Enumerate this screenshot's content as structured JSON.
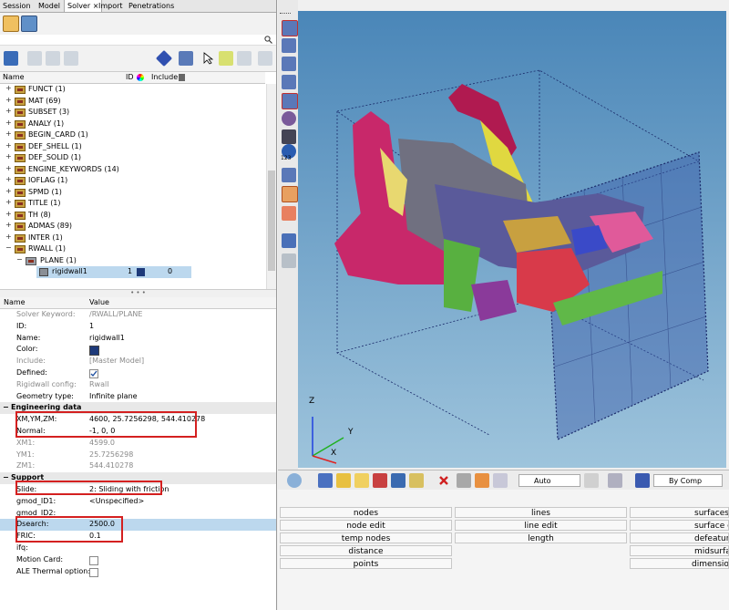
{
  "tabs": [
    "Session",
    "Model",
    "Solver",
    "Import",
    "Penetrations"
  ],
  "active_tab_close": "×",
  "tree": {
    "columns": {
      "name": "Name",
      "id": "ID",
      "include": "Include"
    },
    "items": [
      {
        "label": "FUNCT  (1)"
      },
      {
        "label": "MAT  (69)"
      },
      {
        "label": "SUBSET  (3)"
      },
      {
        "label": "ANALY  (1)"
      },
      {
        "label": "BEGIN_CARD  (1)"
      },
      {
        "label": "DEF_SHELL  (1)"
      },
      {
        "label": "DEF_SOLID  (1)"
      },
      {
        "label": "ENGINE_KEYWORDS  (14)"
      },
      {
        "label": "IOFLAG  (1)"
      },
      {
        "label": "SPMD  (1)"
      },
      {
        "label": "TITLE  (1)"
      },
      {
        "label": "TH  (8)"
      },
      {
        "label": "ADMAS  (89)"
      },
      {
        "label": "INTER  (1)"
      },
      {
        "label": "RWALL  (1)"
      },
      {
        "label": "PLANE  (1)"
      }
    ],
    "selected": {
      "label": "rigidwall1",
      "id": "1",
      "include": "0"
    }
  },
  "splitter_dots": "• • •",
  "props": {
    "columns": {
      "name": "Name",
      "value": "Value"
    },
    "rows": [
      {
        "name": "Solver Keyword:",
        "value": "/RWALL/PLANE"
      },
      {
        "name": "ID:",
        "value": "1"
      },
      {
        "name": "Name:",
        "value": "rigidwall1"
      },
      {
        "name": "Color:",
        "value": ""
      },
      {
        "name": "Include:",
        "value": "[Master Model]"
      },
      {
        "name": "Defined:",
        "value": ""
      },
      {
        "name": "Rigidwall config:",
        "value": "Rwall"
      },
      {
        "name": "Geometry type:",
        "value": "Infinite plane"
      }
    ],
    "section_engineering": "Engineering data",
    "engineering": [
      {
        "name": "XM,YM,ZM:",
        "value": "4600, 25.7256298, 544.410278"
      },
      {
        "name": "Normal:",
        "value": "-1, 0, 0"
      },
      {
        "name": "XM1:",
        "value": "4599.0"
      },
      {
        "name": "YM1:",
        "value": "25.7256298"
      },
      {
        "name": "ZM1:",
        "value": "544.410278"
      }
    ],
    "section_support": "Support",
    "support": [
      {
        "name": "Slide:",
        "value": "2: Sliding with friction"
      },
      {
        "name": "gmod_ID1:",
        "value": "<Unspecified>"
      },
      {
        "name": "gmod_ID2:",
        "value": ""
      },
      {
        "name": "Dsearch:",
        "value": "2500.0"
      },
      {
        "name": "FRIC:",
        "value": "0.1"
      },
      {
        "name": "ifq:",
        "value": ""
      },
      {
        "name": "Motion Card:",
        "value": ""
      },
      {
        "name": "ALE Thermal option:",
        "value": ""
      }
    ]
  },
  "colors": {
    "accent_highlight": "#bcd8ee",
    "red_box": "#d42020",
    "wall_color": "#1e3a7a"
  },
  "vtool_label": "123",
  "triad": {
    "z": "Z",
    "y": "Y",
    "x": "X"
  },
  "bottom_toolbar": {
    "auto": "Auto",
    "bycomp": "By Comp"
  },
  "panel_buttons": {
    "col1": [
      "nodes",
      "node edit",
      "temp nodes",
      "distance",
      "points"
    ],
    "col2": [
      "lines",
      "line edit",
      "length"
    ],
    "col3": [
      "surfaces",
      "surface edit",
      "defeature",
      "midsurface",
      "dimensioning"
    ]
  }
}
